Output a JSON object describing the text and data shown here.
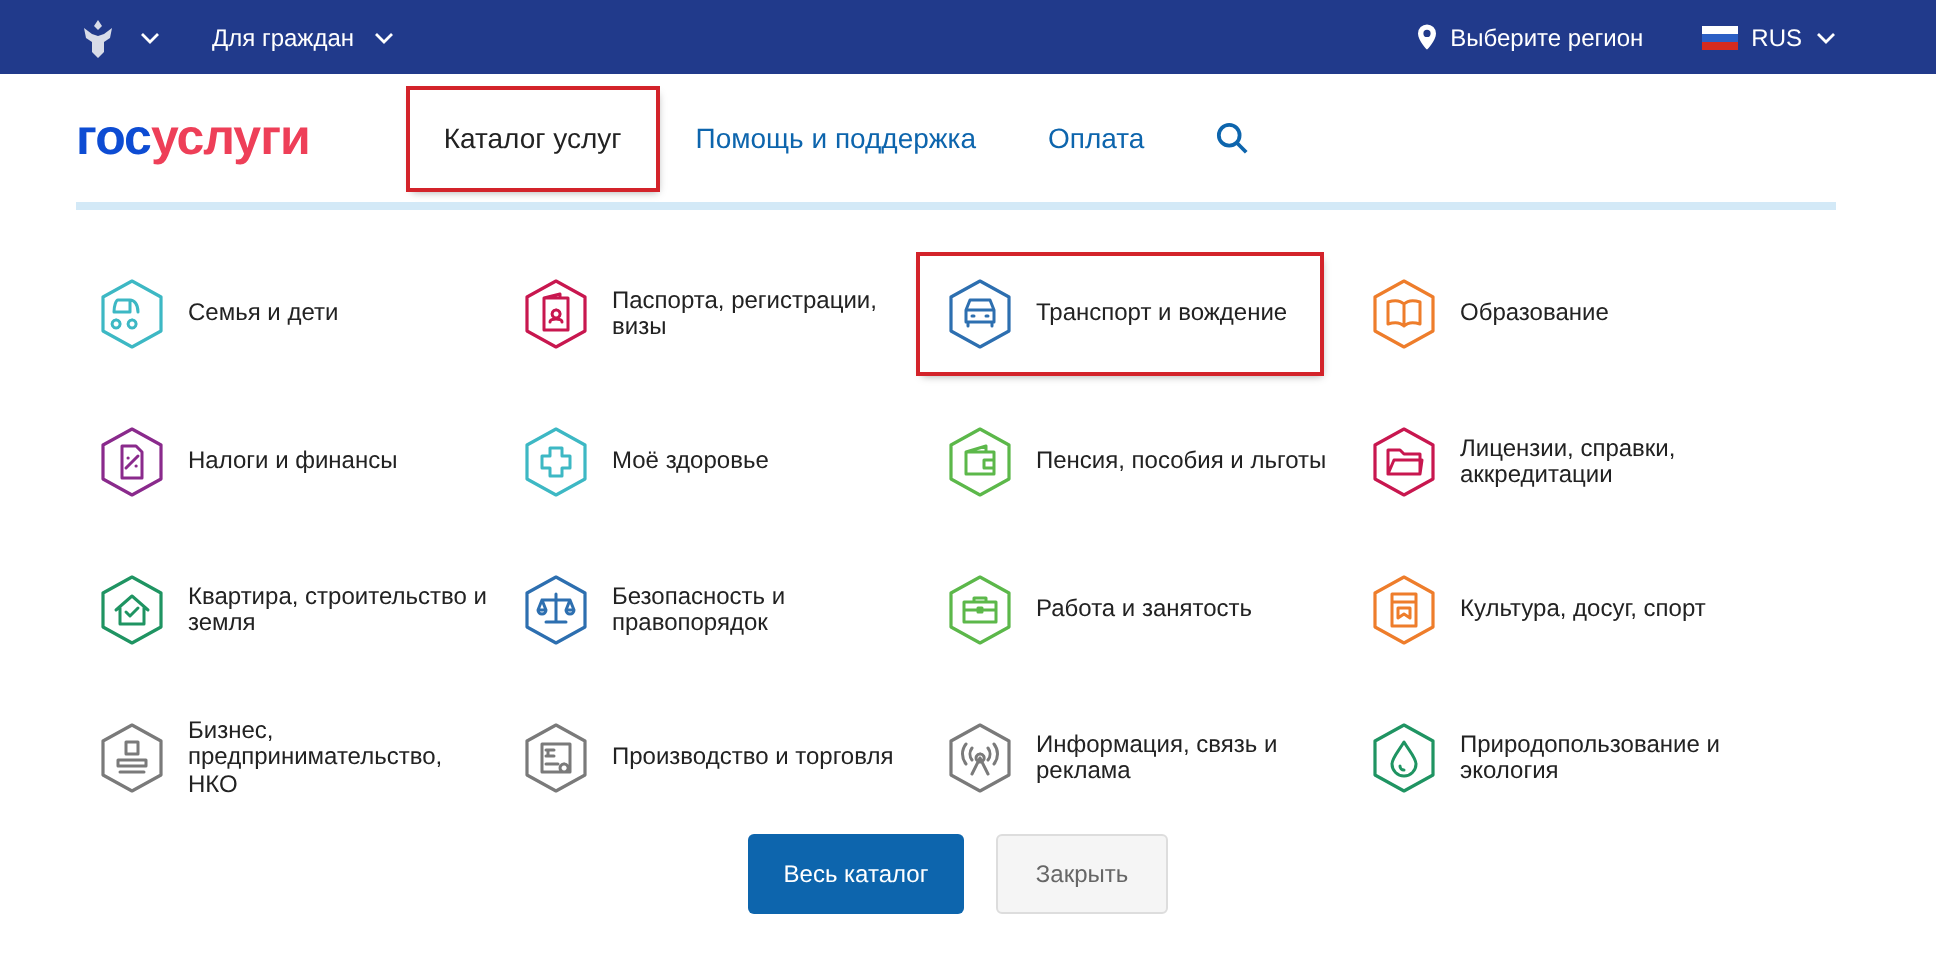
{
  "top_bar": {
    "audience": "Для граждан",
    "region": "Выберите регион",
    "language": "RUS"
  },
  "logo": {
    "part_1": "гос",
    "part_2": "услуги"
  },
  "nav": {
    "items": [
      {
        "label": "Каталог услуг",
        "selected": true,
        "highlighted": true
      },
      {
        "label": "Помощь и поддержка",
        "selected": false,
        "highlighted": false
      },
      {
        "label": "Оплата",
        "selected": false,
        "highlighted": false
      }
    ]
  },
  "categories": [
    {
      "label": "Семья и дети",
      "kind": "stroller",
      "color": "#3db8c4",
      "highlighted": false
    },
    {
      "label": "Паспорта, регистрации, визы",
      "kind": "passport",
      "color": "#c8174f",
      "highlighted": false
    },
    {
      "label": "Транспорт и вождение",
      "kind": "car",
      "color": "#2d6fb0",
      "highlighted": true
    },
    {
      "label": "Образование",
      "kind": "book",
      "color": "#ee7d2b",
      "highlighted": false
    },
    {
      "label": "Налоги и финансы",
      "kind": "tax",
      "color": "#8a2a8c",
      "highlighted": false
    },
    {
      "label": "Моё здоровье",
      "kind": "health",
      "color": "#3db8c4",
      "highlighted": false
    },
    {
      "label": "Пенсия, пособия и льготы",
      "kind": "wallet",
      "color": "#5cb84a",
      "highlighted": false
    },
    {
      "label": "Лицензии, справки, аккредитации",
      "kind": "folder",
      "color": "#c8174f",
      "highlighted": false
    },
    {
      "label": "Квартира, строительство и земля",
      "kind": "house",
      "color": "#1f9462",
      "highlighted": false
    },
    {
      "label": "Безопасность и правопорядок",
      "kind": "scales",
      "color": "#2d6fb0",
      "highlighted": false
    },
    {
      "label": "Работа и занятость",
      "kind": "briefcase",
      "color": "#5cb84a",
      "highlighted": false
    },
    {
      "label": "Культура, досуг, спорт",
      "kind": "culture",
      "color": "#ee7d2b",
      "highlighted": false
    },
    {
      "label": "Бизнес, предпринимательство, НКО",
      "kind": "stamp",
      "color": "#7a7a7a",
      "highlighted": false
    },
    {
      "label": "Производство и торговля",
      "kind": "document",
      "color": "#7a7a7a",
      "highlighted": false
    },
    {
      "label": "Информация, связь и реклама",
      "kind": "antenna",
      "color": "#7a7a7a",
      "highlighted": false
    },
    {
      "label": "Природопользование и экология",
      "kind": "drop",
      "color": "#1f9462",
      "highlighted": false
    }
  ],
  "buttons": [
    {
      "label": "Весь каталог",
      "kind": "primary"
    },
    {
      "label": "Закрыть",
      "kind": "secondary"
    }
  ]
}
